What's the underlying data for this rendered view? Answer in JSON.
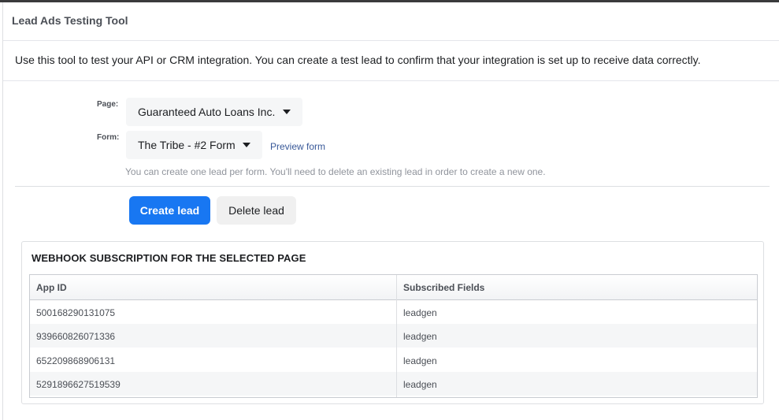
{
  "header": {
    "title": "Lead Ads Testing Tool"
  },
  "description": "Use this tool to test your API or CRM integration. You can create a test lead to confirm that your integration is set up to receive data correctly.",
  "form": {
    "page_label": "Page:",
    "page_value": "Guaranteed Auto Loans Inc.",
    "form_label": "Form:",
    "form_value": "The Tribe - #2 Form",
    "preview_link": "Preview form",
    "hint": "You can create one lead per form. You'll need to delete an existing lead in order to create a new one."
  },
  "actions": {
    "create_label": "Create lead",
    "delete_label": "Delete lead"
  },
  "webhook": {
    "title": "WEBHOOK SUBSCRIPTION FOR THE SELECTED PAGE",
    "columns": [
      "App ID",
      "Subscribed Fields"
    ],
    "rows": [
      {
        "app_id": "500168290131075",
        "fields": "leadgen"
      },
      {
        "app_id": "939660826071336",
        "fields": "leadgen"
      },
      {
        "app_id": "652209868906131",
        "fields": "leadgen"
      },
      {
        "app_id": "5291896627519539",
        "fields": "leadgen"
      }
    ]
  },
  "colors": {
    "primary": "#1877f2",
    "link": "#385898"
  }
}
